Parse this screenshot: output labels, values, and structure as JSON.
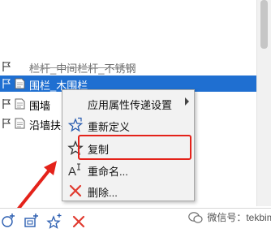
{
  "tree": {
    "rows": [
      {
        "label": "栏杆_中间栏杆_不锈钢",
        "state": "strike"
      },
      {
        "label": "围栏_木围栏",
        "state": "selected"
      },
      {
        "label": "围墙",
        "state": "normal"
      },
      {
        "label": "沿墙扶手",
        "state": "normal"
      }
    ]
  },
  "context_menu": {
    "items": [
      {
        "label": "应用属性传递设置",
        "icon": "none",
        "has_submenu": true
      },
      {
        "label": "重新定义",
        "icon": "star-redefine-icon"
      },
      {
        "label": "复制",
        "icon": "star-copy-icon"
      },
      {
        "label": "重命名...",
        "icon": "rename-icon"
      },
      {
        "label": "删除...",
        "icon": "delete-x-icon"
      }
    ]
  },
  "bottom_toolbar": {
    "buttons": [
      "add-circle-icon",
      "add-folder-icon",
      "add-star-icon",
      "delete-icon"
    ]
  },
  "watermark": {
    "text": "微信号：tekbim"
  },
  "colors": {
    "selection": "#1f6fd1",
    "highlight_box": "#e4221a",
    "delete_red": "#e03a2f"
  }
}
